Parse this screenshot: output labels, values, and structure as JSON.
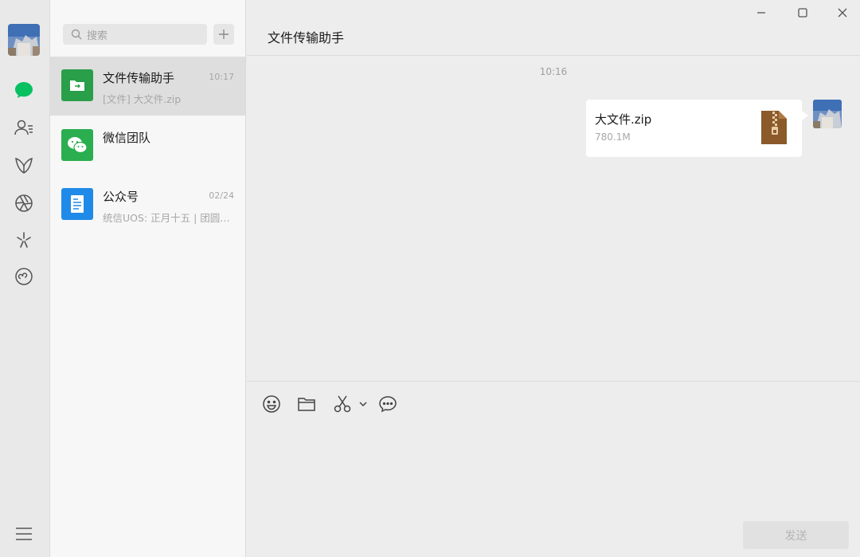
{
  "search": {
    "placeholder": "搜索"
  },
  "conversations": [
    {
      "name": "文件传输助手",
      "time": "10:17",
      "preview": "[文件] 大文件.zip"
    },
    {
      "name": "微信团队",
      "time": "",
      "preview": ""
    },
    {
      "name": "公众号",
      "time": "02/24",
      "preview": "统信UOS: 正月十五 | 团圆…"
    }
  ],
  "chat": {
    "title": "文件传输助手",
    "timestamp": "10:16",
    "message": {
      "file_name": "大文件.zip",
      "file_size": "780.1M"
    }
  },
  "composer": {
    "send_label": "发送"
  },
  "colors": {
    "accent": "#07c160",
    "file_icon": "#8b5a2b",
    "official_blue": "#1f8ae8"
  }
}
